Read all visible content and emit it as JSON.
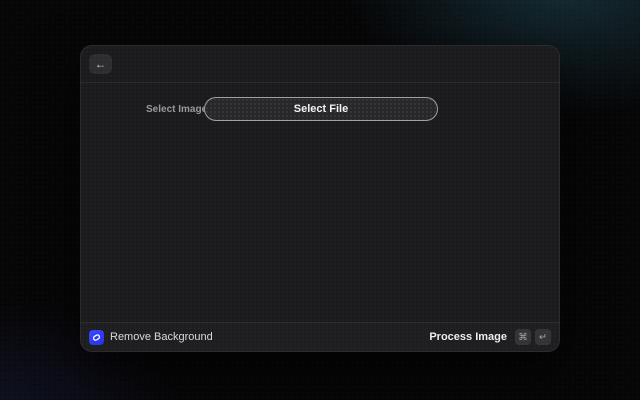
{
  "window": {
    "header": {
      "back_icon": "←"
    },
    "form": {
      "label": "Select Image",
      "button_label": "Select File"
    },
    "footer": {
      "command_icon": "remove-background-icon",
      "command_title": "Remove Background",
      "primary_action": "Process Image",
      "shortcut_keys": [
        "⌘",
        "↵"
      ]
    }
  },
  "colors": {
    "accent_blue": "#3340f5",
    "window_bg": "#1b1b1d",
    "wallpaper_teal": "#18343e",
    "wallpaper_indigo": "#181a3a"
  }
}
